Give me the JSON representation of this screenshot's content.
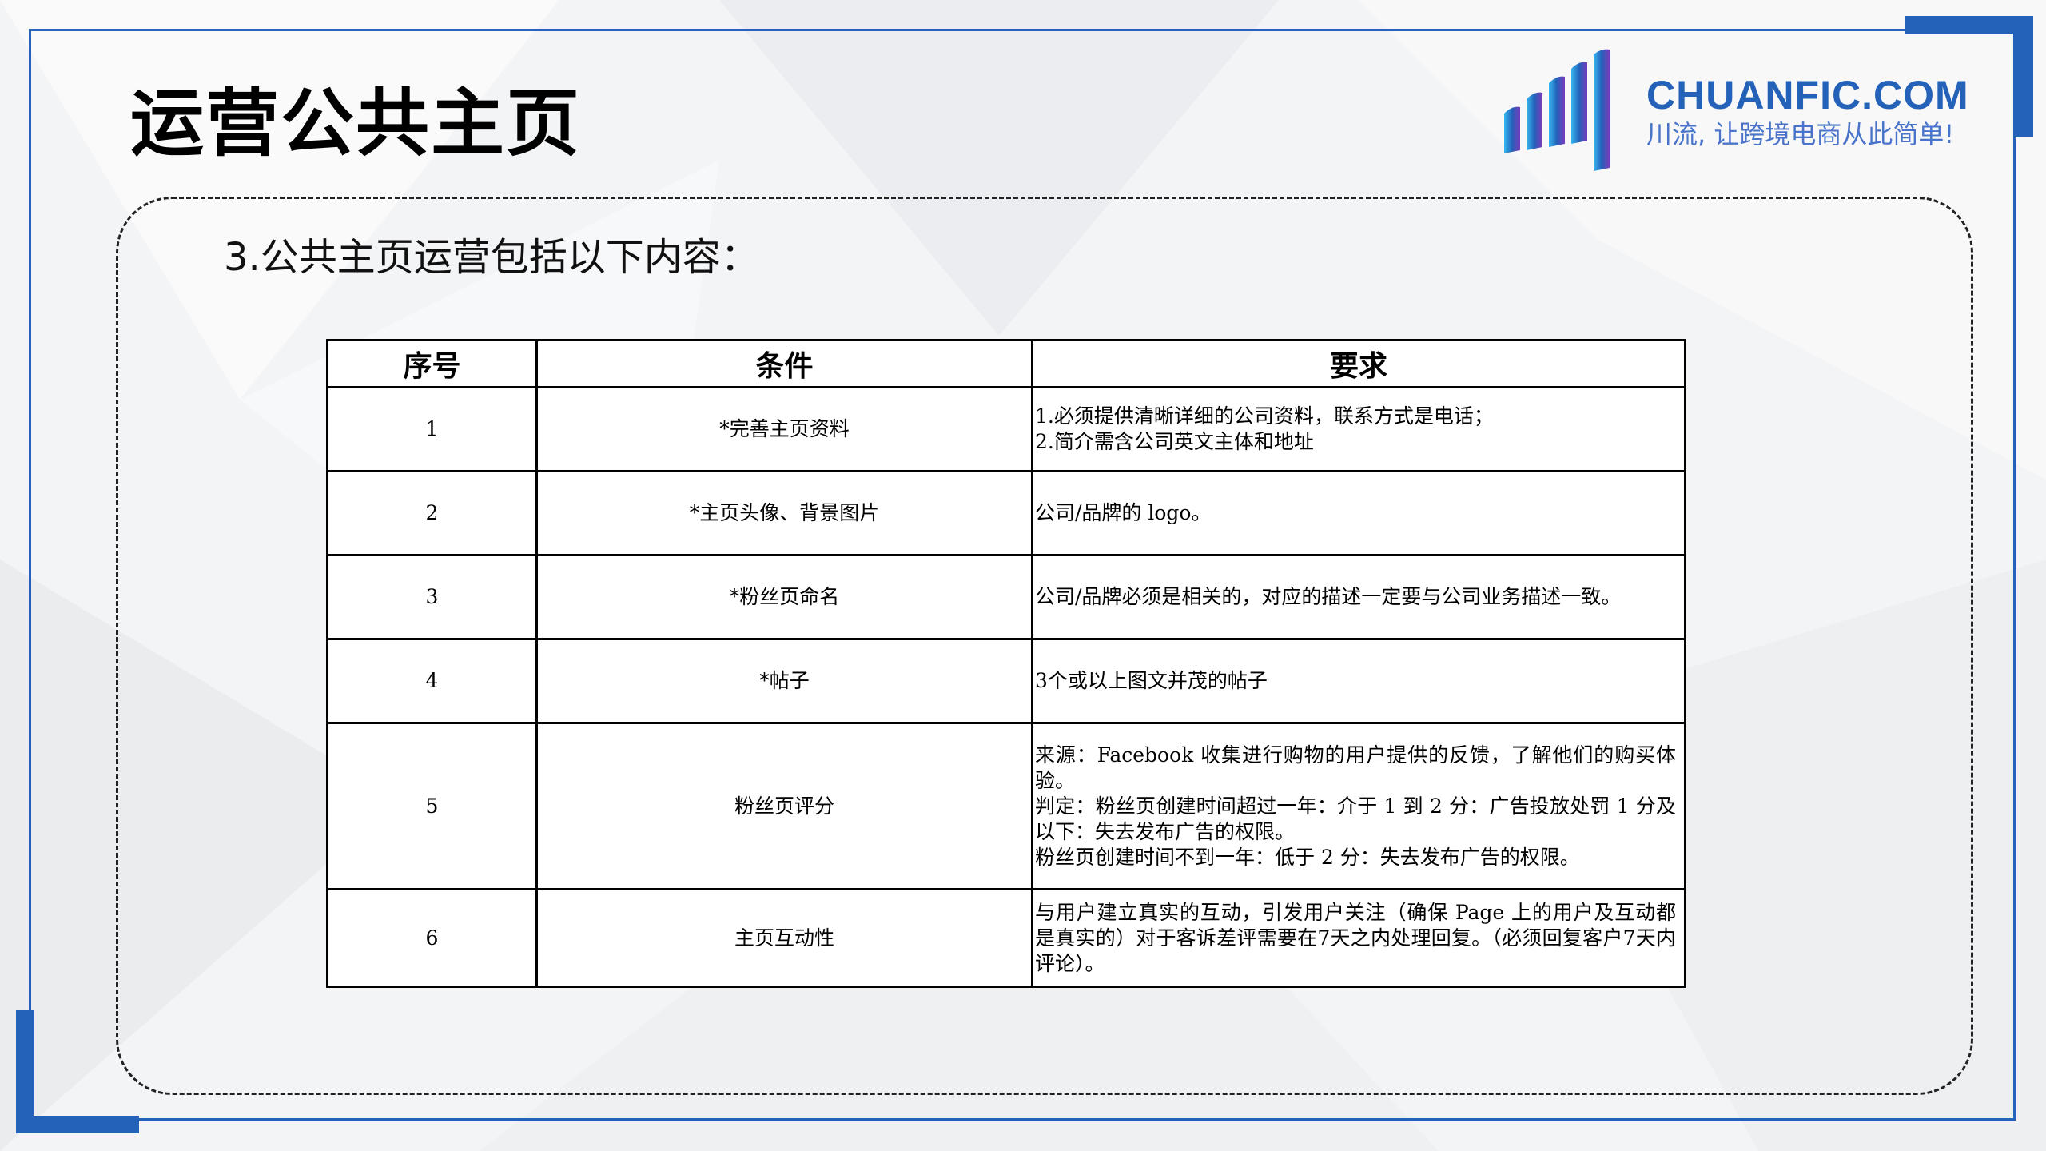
{
  "page_title": "运营公共主页",
  "logo": {
    "name": "CHUANFIC.COM",
    "slogan": "川流, 让跨境电商从此简单!"
  },
  "subtitle": "3.公共主页运营包括以下内容：",
  "table": {
    "headers": [
      "序号",
      "条件",
      "要求"
    ],
    "rows": [
      {
        "no": "1",
        "condition": "*完善主页资料",
        "requirement": [
          "1.必须提供清晰详细的公司资料，联系方式是电话；",
          "2.简介需含公司英文主体和地址"
        ]
      },
      {
        "no": "2",
        "condition": "*主页头像、背景图片",
        "requirement": [
          "公司/品牌的 logo。"
        ]
      },
      {
        "no": "3",
        "condition": "*粉丝页命名",
        "requirement": [
          "公司/品牌必须是相关的，对应的描述一定要与公司业务描述一致。"
        ]
      },
      {
        "no": "4",
        "condition": "*帖子",
        "requirement": [
          "3个或以上图文并茂的帖子"
        ]
      },
      {
        "no": "5",
        "condition": "粉丝页评分",
        "requirement": [
          "来源：Facebook 收集进行购物的用户提供的反馈，了解他们的购买体验。",
          "判定：粉丝页创建时间超过一年：介于 1 到 2 分：广告投放处罚 1 分及以下：失去发布广告的权限。",
          "粉丝页创建时间不到一年：低于 2 分：失去发布广告的权限。"
        ]
      },
      {
        "no": "6",
        "condition": "主页互动性",
        "requirement": [
          "与用户建立真实的互动，引发用户关注（确保 Page 上的用户及互动都是真实的）对于客诉差评需要在7天之内处理回复。（必须回复客户7天内评论）。"
        ]
      }
    ]
  },
  "colors": {
    "accent": "#2461b8",
    "logo_gradient": [
      "#36b8f0",
      "#2461b8",
      "#7a3bbd"
    ]
  }
}
